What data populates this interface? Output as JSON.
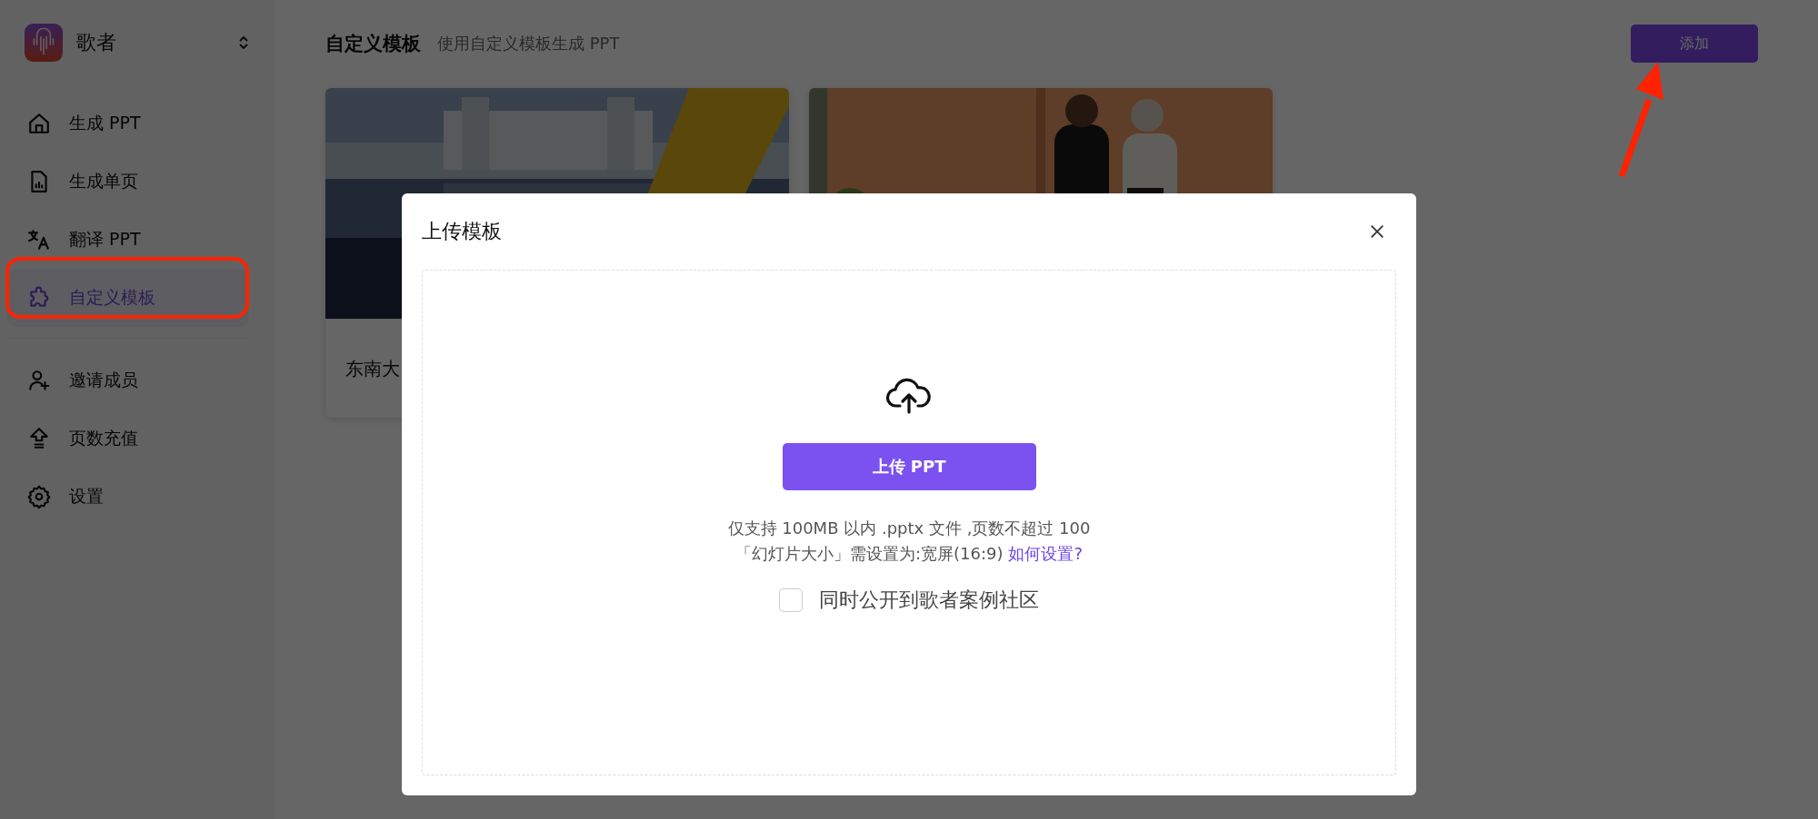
{
  "sidebar": {
    "brand": "歌者",
    "nav_groups": [
      [
        {
          "label": "生成 PPT",
          "selected": false
        },
        {
          "label": "生成单页",
          "selected": false
        },
        {
          "label": "翻译 PPT",
          "selected": false
        },
        {
          "label": "自定义模板",
          "selected": true
        }
      ],
      [
        {
          "label": "邀请成员",
          "selected": false
        },
        {
          "label": "页数充值",
          "selected": false
        },
        {
          "label": "设置",
          "selected": false
        }
      ]
    ]
  },
  "page": {
    "title": "自定义模板",
    "subtitle": "使用自定义模板生成 PPT",
    "add_button": "添加"
  },
  "templates": [
    {
      "kind": "campus",
      "name": "东南大"
    },
    {
      "kind": "office"
    }
  ],
  "modal": {
    "title": "上传模板",
    "upload_button": "上传 PPT",
    "limit_note": "仅支持 100MB 以内 .pptx 文件 ,页数不超过 100",
    "size_note": "「幻灯片大小」需设置为:宽屏(16:9)",
    "help_link": "如何设置?",
    "public_option": {
      "label": "同时公开到歌者案例社区",
      "checked": false
    }
  }
}
